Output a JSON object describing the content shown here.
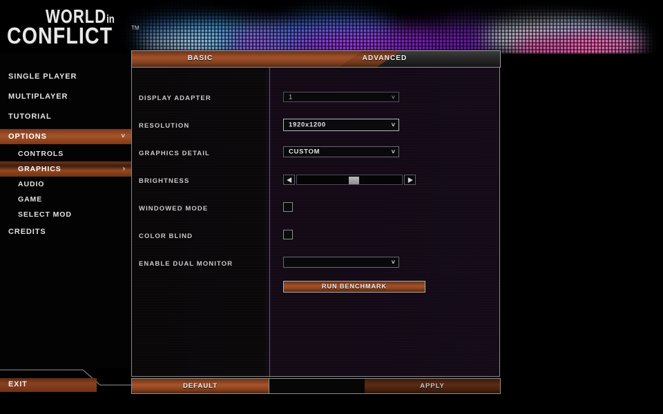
{
  "game": {
    "logo_line1": "WORLD",
    "logo_line1_suffix": "in",
    "logo_line2": "CONFLICT",
    "trademark": "TM"
  },
  "sidebar": {
    "items": [
      {
        "label": "SINGLE PLAYER",
        "level": "top",
        "selected": false,
        "arrow": ""
      },
      {
        "label": "MULTIPLAYER",
        "level": "top",
        "selected": false,
        "arrow": ""
      },
      {
        "label": "TUTORIAL",
        "level": "top",
        "selected": false,
        "arrow": ""
      },
      {
        "label": "OPTIONS",
        "level": "top",
        "selected": true,
        "arrow": "chevron-double-down-icon"
      },
      {
        "label": "CONTROLS",
        "level": "sub",
        "selected": false,
        "arrow": ""
      },
      {
        "label": "GRAPHICS",
        "level": "sub",
        "selected": true,
        "arrow": "chevron-right-icon"
      },
      {
        "label": "AUDIO",
        "level": "sub",
        "selected": false,
        "arrow": ""
      },
      {
        "label": "GAME",
        "level": "sub",
        "selected": false,
        "arrow": ""
      },
      {
        "label": "SELECT MOD",
        "level": "sub",
        "selected": false,
        "arrow": ""
      },
      {
        "label": "CREDITS",
        "level": "top",
        "selected": false,
        "arrow": ""
      }
    ],
    "exit_label": "EXIT"
  },
  "tabs": {
    "basic": "BASIC",
    "advanced": "ADVANCED",
    "active": "BASIC"
  },
  "settings": {
    "display_adapter": {
      "label": "DISPLAY ADAPTER",
      "value": "1",
      "caret": "chevron-down-icon"
    },
    "resolution": {
      "label": "RESOLUTION",
      "value": "1920x1200",
      "caret": "chevron-down-icon",
      "highlighted": true
    },
    "graphics_detail": {
      "label": "GRAPHICS DETAIL",
      "value": "CUSTOM",
      "caret": "chevron-down-icon"
    },
    "brightness": {
      "label": "BRIGHTNESS",
      "value_percent": 55,
      "left_arrow": "triangle-left-icon",
      "right_arrow": "triangle-right-icon"
    },
    "windowed_mode": {
      "label": "WINDOWED MODE",
      "checked": false
    },
    "color_blind": {
      "label": "COLOR BLIND",
      "checked": false
    },
    "enable_dual_monitor": {
      "label": "ENABLE DUAL MONITOR",
      "value": "",
      "caret": "chevron-down-icon"
    },
    "run_benchmark": {
      "label": "RUN BENCHMARK"
    }
  },
  "footer": {
    "default_label": "DEFAULT",
    "apply_label": "APPLY"
  },
  "colors": {
    "accent_orange": "#a4522a",
    "accent_orange_dark": "#5b2b15",
    "panel_border": "#8c8c8c",
    "text_primary": "#e2e2e2",
    "background": "#000000"
  }
}
